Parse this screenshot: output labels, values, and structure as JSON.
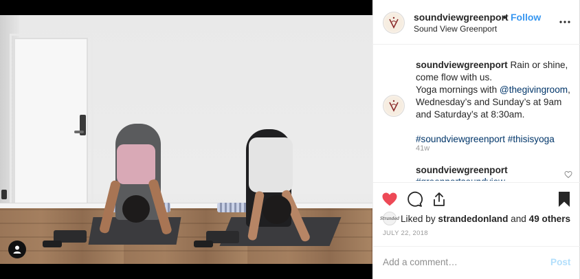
{
  "post": {
    "username": "soundviewgreenport",
    "separator": "•",
    "follow_label": "Follow",
    "location": "Sound View Greenport",
    "more_icon": "more-options-icon"
  },
  "caption": {
    "username": "soundviewgreenport",
    "line1": " Rain or shine, come flow with us.",
    "line2_prefix": "Yoga mornings with ",
    "mention": "@thegivingroom",
    "line2_suffix": ", Wednesday’s and Sunday’s at 9am and Saturday’s at 8:30am.",
    "hashtag1": "#soundviewgreenport",
    "hashtag2": "#thisisyoga",
    "time": "41w"
  },
  "comment": {
    "username": "soundviewgreenport",
    "partial_text": "#greenportsoundview #jacobsbeach"
  },
  "likes": {
    "prefix": "Liked by ",
    "user": "strandedonland",
    "middle": " and ",
    "others": "49 others",
    "liker_avatar_text": "Stranded"
  },
  "date": "JULY 22, 2018",
  "add_comment": {
    "placeholder": "Add a comment…",
    "post_label": "Post"
  },
  "colors": {
    "like_red": "#ed4956",
    "link_blue": "#3897f0",
    "hashtag_blue": "#003569",
    "post_disabled": "#b2dffc"
  }
}
